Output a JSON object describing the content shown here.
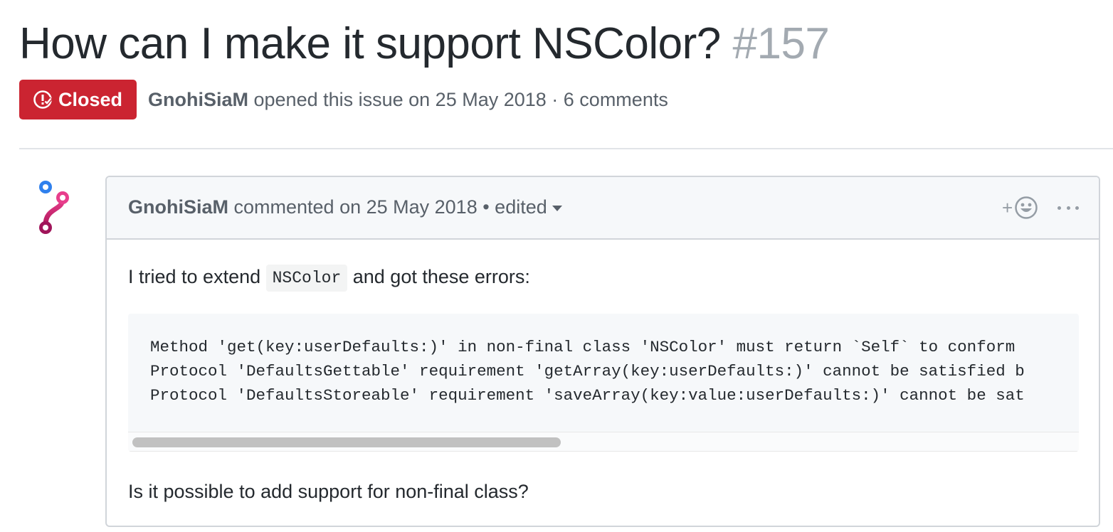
{
  "issue": {
    "title": "How can I make it support NSColor?",
    "number": "#157",
    "state": "Closed",
    "state_color": "#cb2431",
    "author": "GnohiSiaM",
    "opened_text": " opened this issue on 25 May 2018 · 6 comments"
  },
  "comment": {
    "avatar_icon": "git-branch-logo-icon",
    "author": "GnohiSiaM",
    "commented_text": " commented on 25 May 2018 • ",
    "edited_label": "edited",
    "reaction_plus": "+",
    "reaction_icon": "smiley-icon",
    "more_icon": "kebab-horizontal-icon",
    "body": {
      "para1_before": "I tried to extend ",
      "para1_code": "NSColor",
      "para1_after": " and got these errors:",
      "code_lines": [
        "Method 'get(key:userDefaults:)' in non-final class 'NSColor' must return `Self` to conform",
        "Protocol 'DefaultsGettable' requirement 'getArray(key:userDefaults:)' cannot be satisfied b",
        "Protocol 'DefaultsStoreable' requirement 'saveArray(key:value:userDefaults:)' cannot be sat"
      ],
      "para2": "Is it possible to add support for non-final class?"
    }
  }
}
